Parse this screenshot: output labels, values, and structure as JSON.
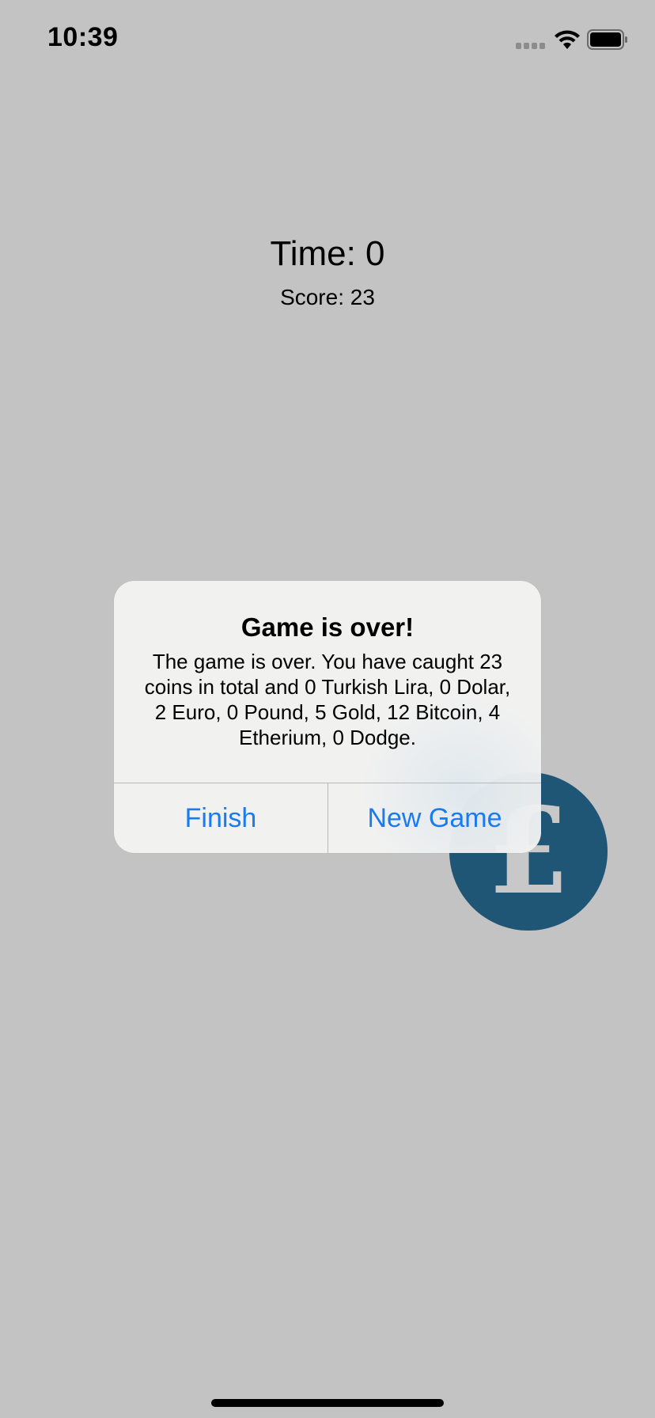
{
  "status_bar": {
    "time": "10:39",
    "icons": [
      "signal-icon",
      "wifi-icon",
      "battery-icon"
    ]
  },
  "hud": {
    "time_label": "Time: 0",
    "score_label": "Score: 23"
  },
  "coin": {
    "symbol": "£",
    "color": "#1f5575",
    "icon": "pound-coin-icon"
  },
  "alert": {
    "title": "Game is over!",
    "message": "The game is over. You have caught 23 coins in total and 0 Turkish Lira, 0 Dolar, 2 Euro, 0 Pound, 5 Gold, 12 Bitcoin, 4 Etherium, 0 Dodge.",
    "buttons": {
      "finish": "Finish",
      "new_game": "New Game"
    },
    "button_color": "#1a7bf0"
  },
  "colors": {
    "background": "#c3c3c3"
  }
}
